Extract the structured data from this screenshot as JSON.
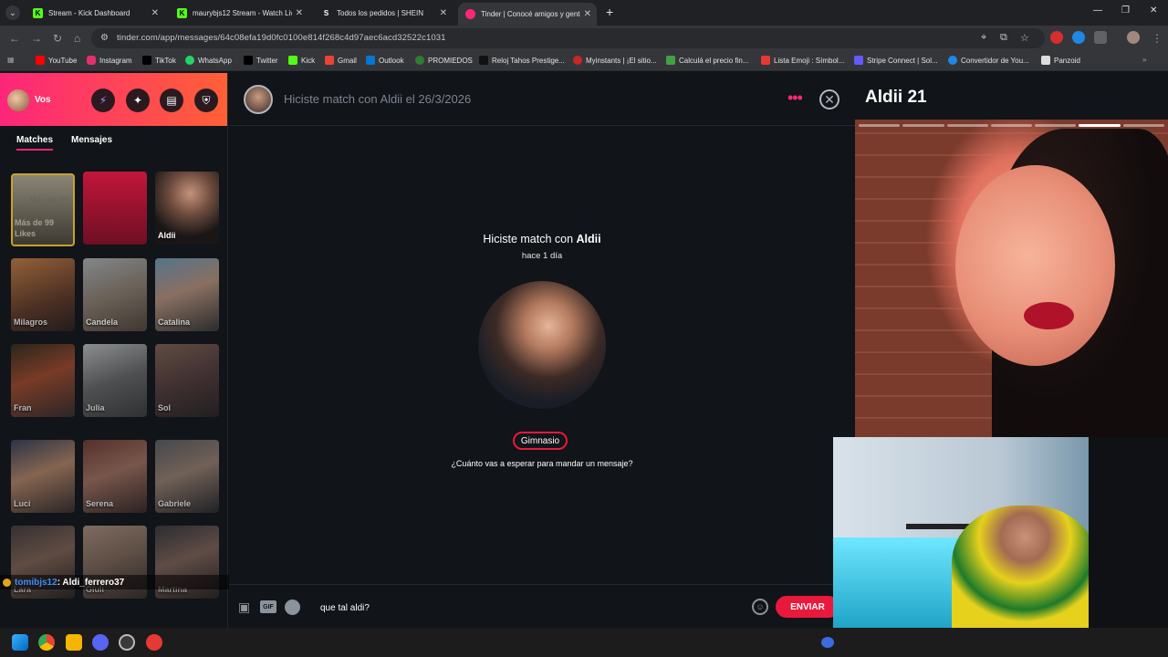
{
  "browser": {
    "tabs": [
      {
        "title": "Stream - Kick Dashboard",
        "icon": "kick-icon",
        "color": "#53fc18",
        "glyph": "K"
      },
      {
        "title": "maurybjs12 Stream - Watch Live",
        "icon": "kick-icon",
        "color": "#53fc18",
        "glyph": "K"
      },
      {
        "title": "Todos los pedidos | SHEIN",
        "icon": "shein-icon",
        "color": "#ffffff",
        "glyph": "S"
      },
      {
        "title": "Tinder | Conocé amigos y gente",
        "icon": "tinder-icon",
        "color": "#fd267a",
        "glyph": ""
      }
    ],
    "url": "tinder.com/app/messages/64c08efa19d0fc0100e814f268c4d97aec6acd32522c1031",
    "bookmarks": [
      {
        "label": "YouTube",
        "color": "#ff0000"
      },
      {
        "label": "Instagram",
        "color": "#e1306c"
      },
      {
        "label": "TikTok",
        "color": "#000000"
      },
      {
        "label": "WhatsApp",
        "color": "#25d366"
      },
      {
        "label": "Twitter",
        "color": "#000000"
      },
      {
        "label": "Kick",
        "color": "#53fc18"
      },
      {
        "label": "Gmail",
        "color": "#ea4335"
      },
      {
        "label": "Outlook",
        "color": "#0078d4"
      },
      {
        "label": "PROMIEDOS",
        "color": "#2e7d32"
      },
      {
        "label": "Reloj Tahos Prestige...",
        "color": "#111111"
      },
      {
        "label": "Myinstants | ¡El sitio...",
        "color": "#c62828"
      },
      {
        "label": "Calculá el precio fin...",
        "color": "#43a047"
      },
      {
        "label": "Lista Emoji : Símbol...",
        "color": "#e53935"
      },
      {
        "label": "Stripe Connect | Sol...",
        "color": "#635bff"
      },
      {
        "label": "Convertidor de You...",
        "color": "#1e88e5"
      },
      {
        "label": "Panzoid",
        "color": "#dddddd"
      }
    ]
  },
  "sidebar": {
    "me_label": "Vos",
    "tabs": [
      "Matches",
      "Mensajes"
    ],
    "likes_label": "Más de 99 Likes",
    "likes_badge": "Más de 99",
    "matches": [
      "Aldii",
      "Milagros",
      "Candela",
      "Catalina",
      "Fran",
      "Julia",
      "Sol",
      "Luci",
      "Serena",
      "Gabriele",
      "Lara",
      "Giuli",
      "Martina"
    ]
  },
  "chat": {
    "header_text": "Hiciste match con Aldii el 26/3/2026",
    "match_prefix": "Hiciste match con ",
    "match_name": "Aldii",
    "match_time": "hace 1 día",
    "interest": "Gimnasio",
    "prompt": "¿Cuánto vas a esperar para mandar un mensaje?",
    "input_value": "que tal aldi?",
    "send_label": "ENVIAR",
    "gif_label": "GIF"
  },
  "profile": {
    "name_age": "Aldii 21",
    "photo_count": 7,
    "active_photo": 6
  },
  "stream_chat": {
    "user": "tomibjs12",
    "message": ": Aldi_ferrero37"
  },
  "colors": {
    "tinder_pink": "#fd267a",
    "tinder_orange": "#ff6036",
    "send_red": "#e8193c",
    "chat_user": "#3d8bfd"
  }
}
